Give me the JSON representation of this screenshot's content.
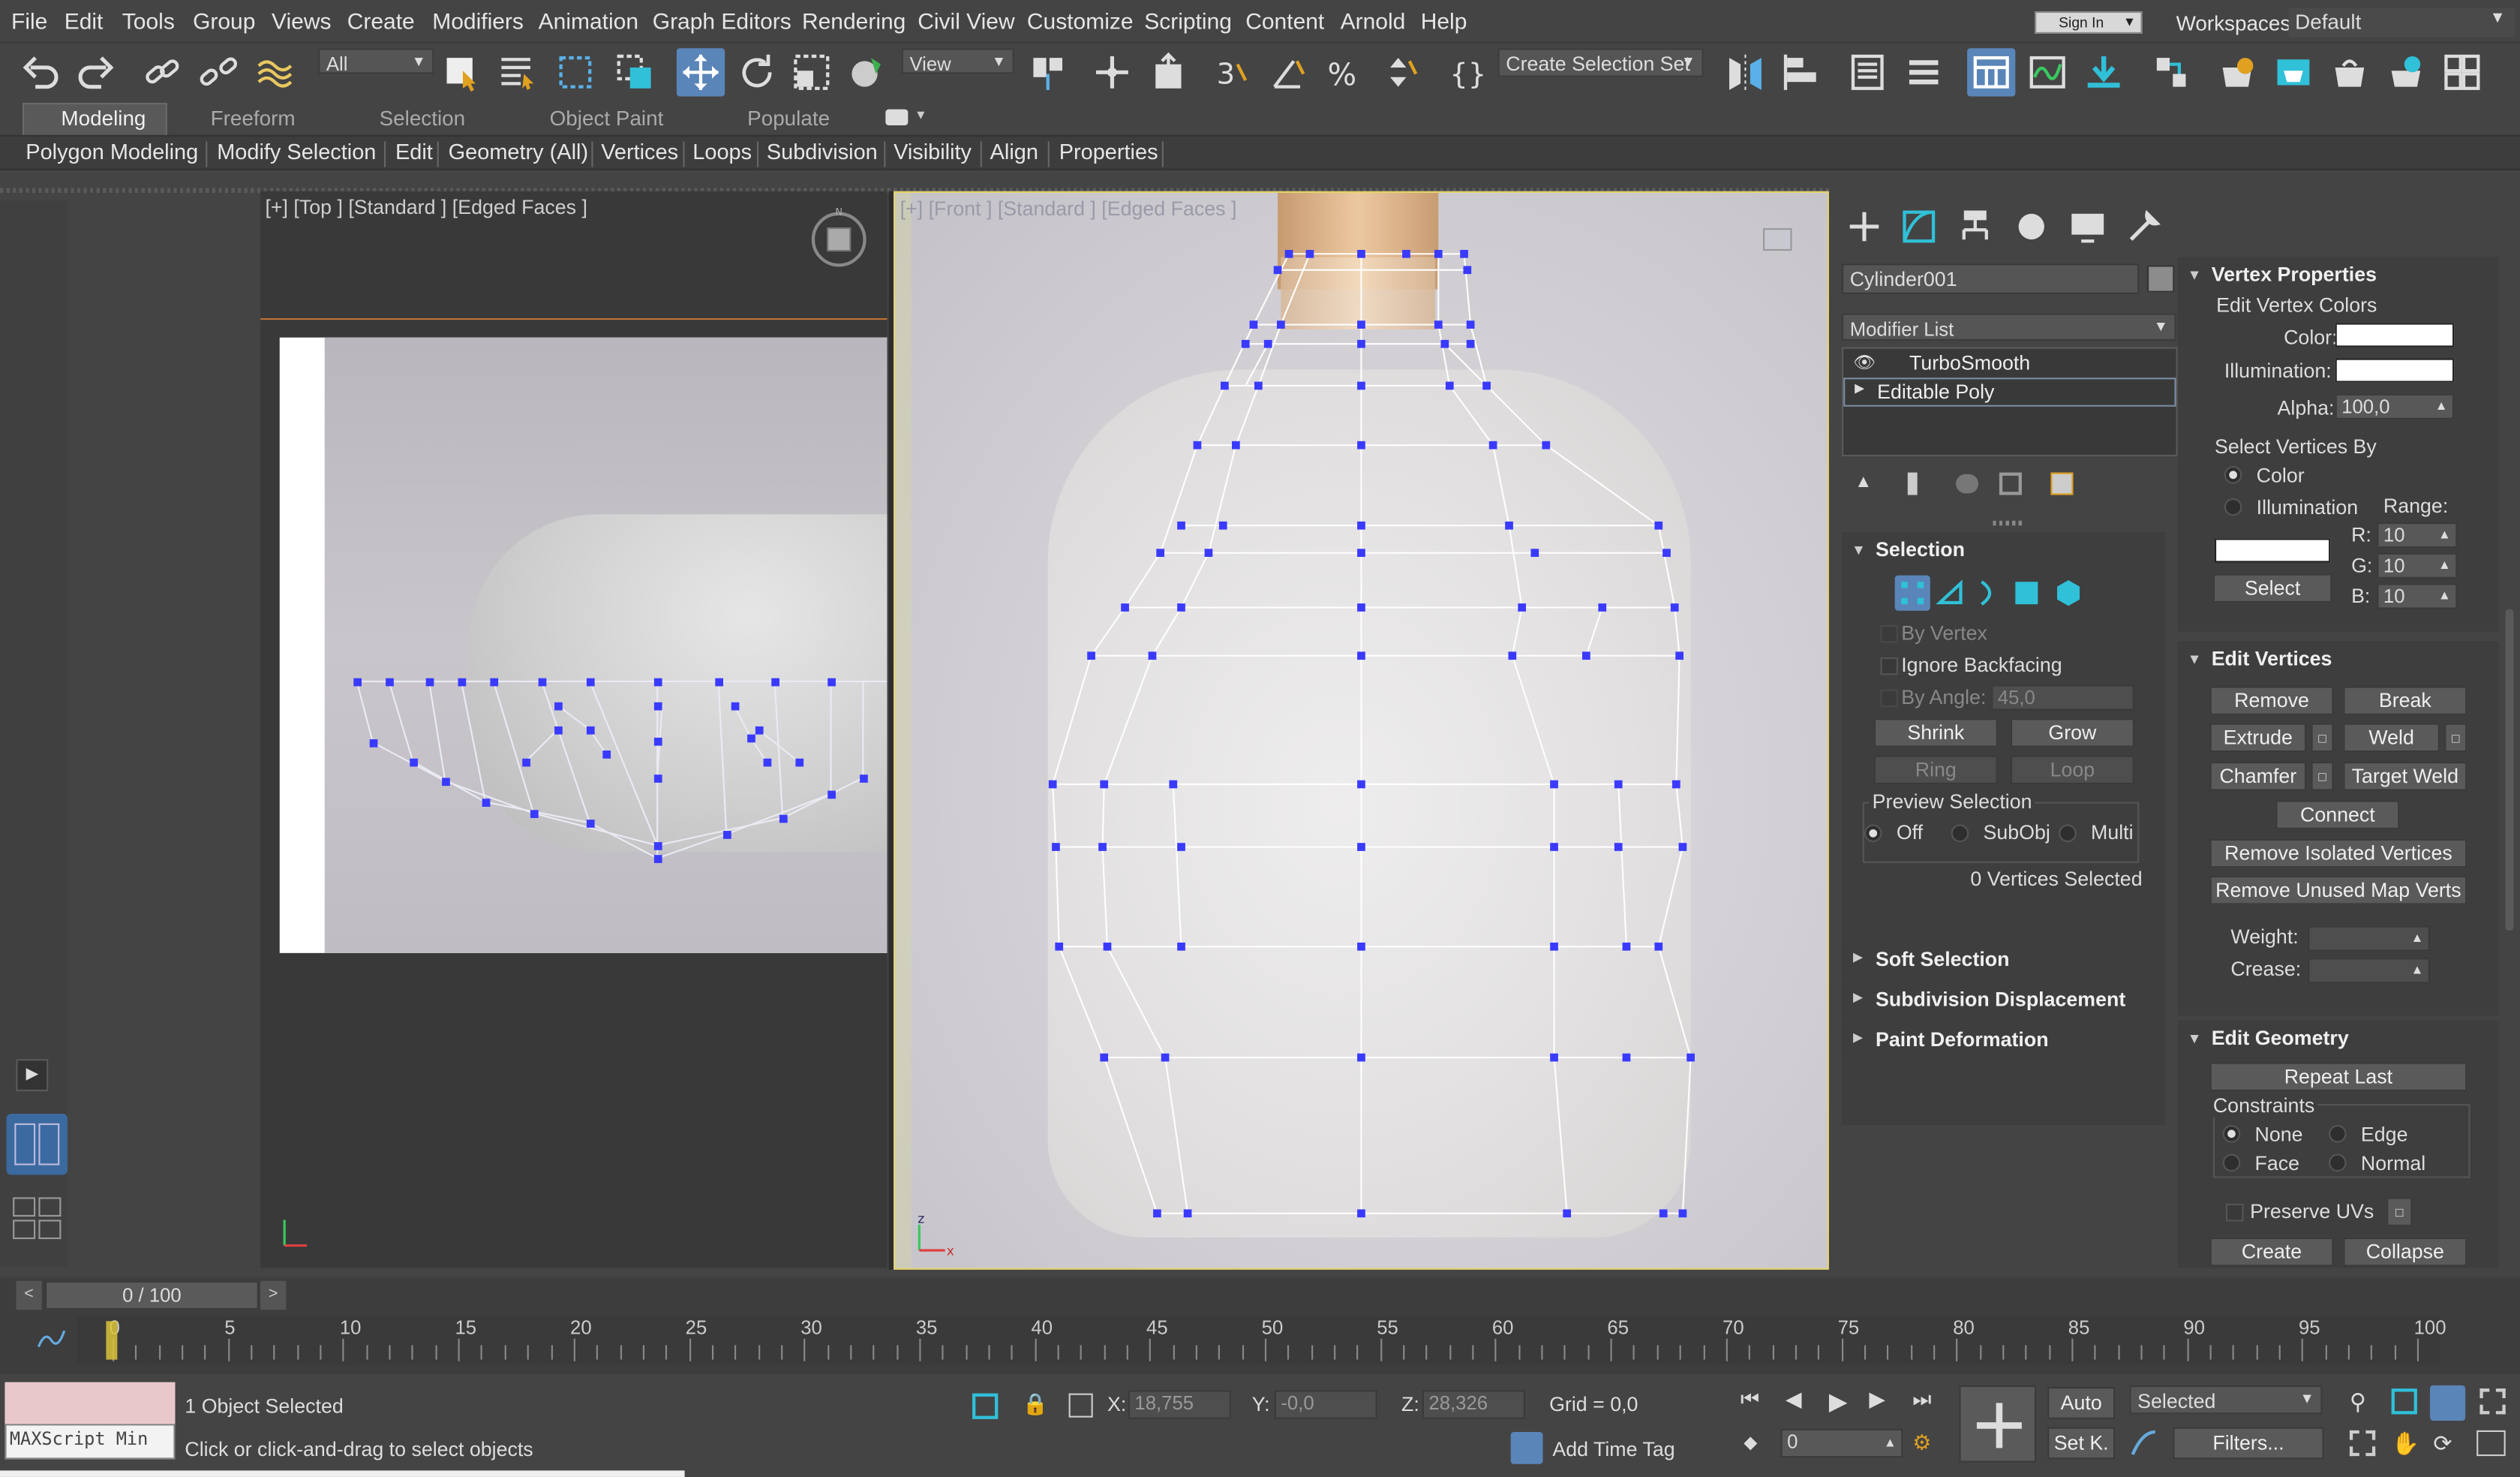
{
  "menu": [
    "File",
    "Edit",
    "Tools",
    "Group",
    "Views",
    "Create",
    "Modifiers",
    "Animation",
    "Graph Editors",
    "Rendering",
    "Civil View",
    "Customize",
    "Scripting",
    "Content",
    "Arnold",
    "Help"
  ],
  "signin": "Sign In",
  "workspaces_label": "Workspaces:",
  "workspace_value": "Default",
  "toolbar": {
    "filter_value": "All",
    "ref_coord": "View",
    "selection_set_placeholder": "Create Selection Set"
  },
  "ribbon": {
    "tabs": [
      "Modeling",
      "Freeform",
      "Selection",
      "Object Paint",
      "Populate"
    ],
    "active_tab": "Modeling",
    "sub": [
      "Polygon Modeling",
      "Modify Selection",
      "Edit",
      "Geometry (All)",
      "Vertices",
      "Loops",
      "Subdivision",
      "Visibility",
      "Align",
      "Properties"
    ]
  },
  "viewports": {
    "top_label": "[+] [Top ] [Standard ] [Edged Faces ]",
    "front_label": "[+] [Front ] [Standard ] [Edged Faces ]"
  },
  "cmd": {
    "object_name": "Cylinder001",
    "object_color": "#8c8c8c",
    "modifier_list": "Modifier List",
    "stack": [
      "TurboSmooth",
      "Editable Poly"
    ],
    "selection": {
      "title": "Selection",
      "by_vertex": "By Vertex",
      "ignore_backfacing": "Ignore Backfacing",
      "by_angle": "By Angle:",
      "by_angle_value": "45,0",
      "shrink": "Shrink",
      "grow": "Grow",
      "ring": "Ring",
      "loop": "Loop",
      "preview_selection": "Preview Selection",
      "off": "Off",
      "subobj": "SubObj",
      "multi": "Multi",
      "status": "0 Vertices Selected"
    },
    "soft_selection": "Soft Selection",
    "subdivision_displacement": "Subdivision Displacement",
    "paint_deformation": "Paint Deformation",
    "vertex_props": {
      "title": "Vertex Properties",
      "edit_colors": "Edit Vertex Colors",
      "color": "Color:",
      "illumination": "Illumination:",
      "alpha": "Alpha:",
      "alpha_value": "100,0",
      "select_by": "Select Vertices By",
      "opt_color": "Color",
      "opt_illum": "Illumination",
      "range": "Range:",
      "r": "R:",
      "g": "G:",
      "b": "B:",
      "r_val": "10",
      "g_val": "10",
      "b_val": "10",
      "select": "Select"
    },
    "edit_vertices": {
      "title": "Edit Vertices",
      "remove": "Remove",
      "break": "Break",
      "extrude": "Extrude",
      "weld": "Weld",
      "chamfer": "Chamfer",
      "target_weld": "Target Weld",
      "connect": "Connect",
      "remove_isolated": "Remove Isolated Vertices",
      "remove_unused": "Remove Unused Map Verts",
      "weight": "Weight:",
      "crease": "Crease:"
    },
    "edit_geometry": {
      "title": "Edit Geometry",
      "repeat_last": "Repeat Last",
      "constraints": "Constraints",
      "none": "None",
      "edge": "Edge",
      "face": "Face",
      "normal": "Normal",
      "preserve_uvs": "Preserve UVs",
      "create": "Create",
      "collapse": "Collapse"
    }
  },
  "timeline": {
    "frame_display": "0 / 100",
    "ticks": [
      "0",
      "5",
      "10",
      "15",
      "20",
      "25",
      "30",
      "35",
      "40",
      "45",
      "50",
      "55",
      "60",
      "65",
      "70",
      "75",
      "80",
      "85",
      "90",
      "95",
      "100"
    ]
  },
  "status": {
    "maxscript": "MAXScript Min",
    "objects": "1 Object Selected",
    "prompt": "Click or click-and-drag to select objects",
    "x_label": "X:",
    "x": "18,755",
    "y_label": "Y:",
    "y": "-0,0",
    "z_label": "Z:",
    "z": "28,326",
    "grid": "Grid = 0,0",
    "add_time_tag": "Add Time Tag",
    "auto": "Auto",
    "setk": "Set K.",
    "key_mode": "Selected",
    "filters": "Filters...",
    "frame": "0"
  }
}
